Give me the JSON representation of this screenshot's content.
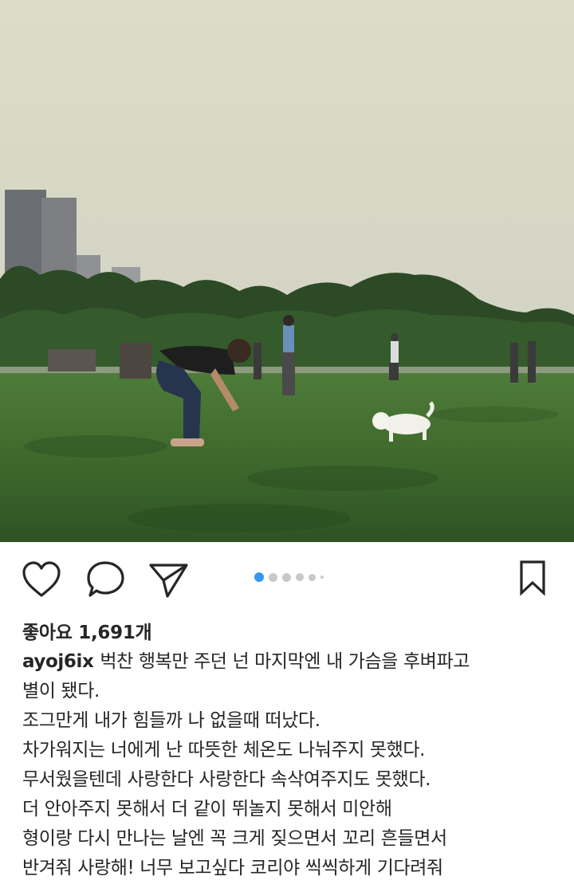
{
  "post": {
    "likes_text": "좋아요 1,691개",
    "username": "ayoj6ix",
    "caption_lines": [
      "벅찬 행복만 주던 넌 마지막엔 내 가슴을 후벼파고",
      "별이 됐다.",
      "조그만게 내가 힘들까 나 없을때 떠났다.",
      "차가워지는 너에게 난 따뜻한 체온도 나눠주지 못했다.",
      "무서웠을텐데 사랑한다 사랑한다 속삭여주지도 못했다.",
      "더 안아주지 못해서 더 같이 뛰놀지 못해서 미안해",
      "형이랑 다시 만나는 날엔 꼭 크게 짖으면서 꼬리 흔들면서",
      "반겨줘 사랑해!  너무 보고싶다 코리야 씩씩하게 기다려줘"
    ]
  },
  "carousel": {
    "count": 5,
    "active_index": 0
  },
  "icons": {
    "like": "heart-icon",
    "comment": "comment-bubble-icon",
    "share": "paper-plane-icon",
    "save": "bookmark-icon"
  },
  "colors": {
    "text": "#262626",
    "dot_active": "#3897f0",
    "dot_inactive": "#c8c8c8"
  }
}
